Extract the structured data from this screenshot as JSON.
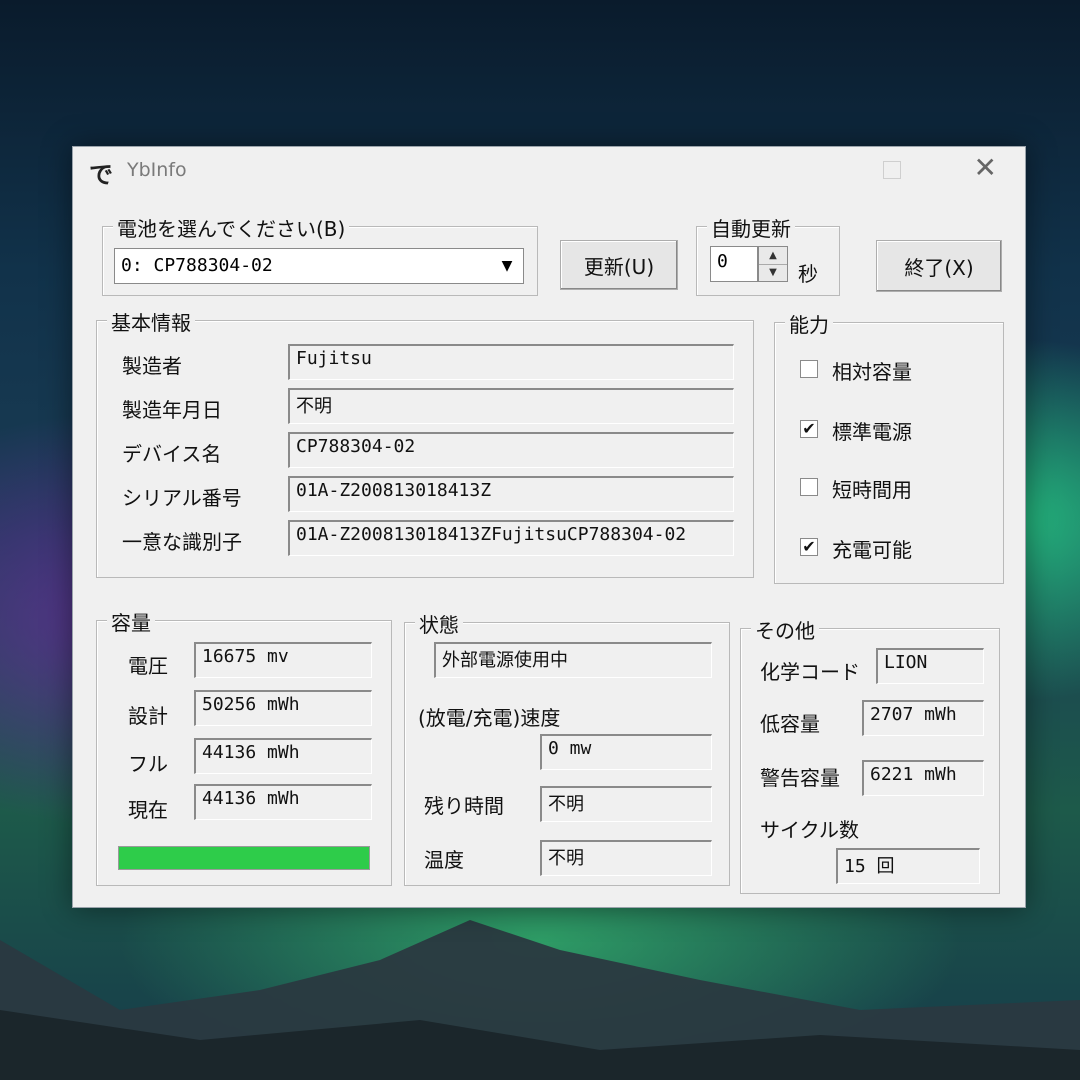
{
  "window": {
    "title": "YbInfo",
    "icon_glyph": "で"
  },
  "battery_select": {
    "legend": "電池を選んでください(B)",
    "selected": "0: CP788304-02"
  },
  "buttons": {
    "refresh": "更新(U)",
    "exit": "終了(X)"
  },
  "auto_refresh": {
    "legend": "自動更新",
    "value": "0",
    "unit": "秒"
  },
  "basic_info": {
    "legend": "基本情報",
    "rows": [
      {
        "label": "製造者",
        "value": "Fujitsu"
      },
      {
        "label": "製造年月日",
        "value": "不明"
      },
      {
        "label": "デバイス名",
        "value": "CP788304-02"
      },
      {
        "label": "シリアル番号",
        "value": "01A-Z200813018413Z"
      },
      {
        "label": "一意な識別子",
        "value": "01A-Z200813018413ZFujitsuCP788304-02"
      }
    ]
  },
  "capabilities": {
    "legend": "能力",
    "items": [
      {
        "label": "相対容量",
        "checked": false,
        "mark": ""
      },
      {
        "label": "標準電源",
        "checked": true,
        "mark": "✔"
      },
      {
        "label": "短時間用",
        "checked": false,
        "mark": ""
      },
      {
        "label": "充電可能",
        "checked": true,
        "mark": "✔"
      }
    ]
  },
  "capacity": {
    "legend": "容量",
    "rows": [
      {
        "label": "電圧",
        "value": "16675 mv"
      },
      {
        "label": "設計",
        "value": "50256 mWh"
      },
      {
        "label": "フル",
        "value": "44136 mWh"
      },
      {
        "label": "現在",
        "value": "44136 mWh"
      }
    ],
    "charge_fraction": 1.0,
    "bar_color": "#2ecc4a"
  },
  "status": {
    "legend": "状態",
    "power_source": "外部電源使用中",
    "rate_label": "(放電/充電)速度",
    "rate_value": "0 mw",
    "remaining_label": "残り時間",
    "remaining_value": "不明",
    "temp_label": "温度",
    "temp_value": "不明"
  },
  "other": {
    "legend": "その他",
    "chemistry_label": "化学コード",
    "chemistry_value": "LION",
    "low_label": "低容量",
    "low_value": "2707 mWh",
    "warn_label": "警告容量",
    "warn_value": "6221 mWh",
    "cycle_label": "サイクル数",
    "cycle_value": "15 回"
  }
}
